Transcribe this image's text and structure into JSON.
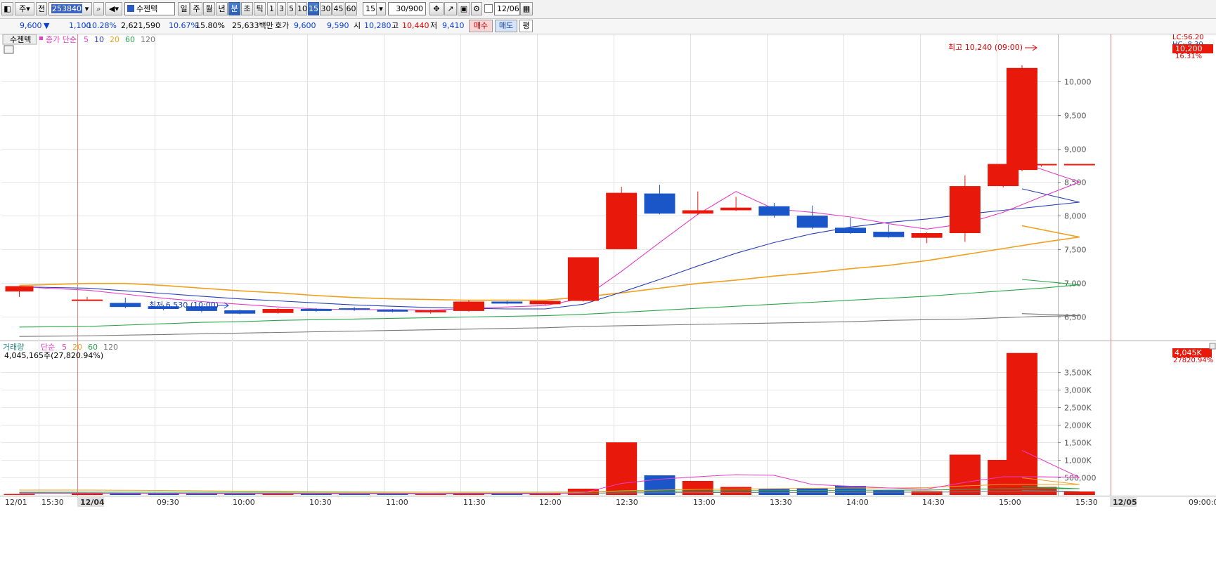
{
  "toolbar": {
    "period_label": "주",
    "prefix_label": "전",
    "code": "253840",
    "stock_name": "수젠텍",
    "tf_day": "일",
    "tf_week": "주",
    "tf_month": "월",
    "tf_year": "년",
    "tf_minute": "분",
    "tf_second": "초",
    "tf_tick": "틱",
    "intervals": [
      "1",
      "3",
      "5",
      "10",
      "15",
      "30",
      "45",
      "60"
    ],
    "interval_value": "15",
    "count_value": "30/900",
    "date_value": "12/06"
  },
  "info": {
    "price": "9,600",
    "change": "1,100",
    "change_pct": "-10.28%",
    "volume": "2,621,590",
    "pct1": "10.67%",
    "pct2": "15.80%",
    "amount": "25,633백만",
    "quote_label": "호가",
    "ask": "9,600",
    "bid": "9,590",
    "open_label": "시",
    "open": "10,280",
    "high_label": "고",
    "high": "10,440",
    "low_label": "저",
    "low": "9,410",
    "buy_label": "매수",
    "sell_label": "매도",
    "avg_label": "평"
  },
  "price_panel": {
    "legend_name": "수젠텍",
    "legend_ma_label": "종가 단순",
    "ma_periods": [
      "5",
      "10",
      "20",
      "60",
      "120"
    ],
    "annot_high": "최고 10,240 (09:00)",
    "annot_low": "최저 6,530 (10:00)",
    "lc_label": "LC:56.20",
    "hc_label": "HC:-8.30",
    "current_price": "10,200",
    "current_pct": "16.31%",
    "y_ticks": [
      "10,000",
      "9,500",
      "9,000",
      "8,500",
      "8,000",
      "7,500",
      "7,000",
      "6,500"
    ]
  },
  "volume_panel": {
    "legend_label": "거래량",
    "legend_ma_label": "단순",
    "ma_periods": [
      "5",
      "20",
      "60",
      "120"
    ],
    "current_text": "4,045,165주(27,820.94%)",
    "current_tag": "4,045K",
    "current_pct": "27820.94%",
    "y_ticks": [
      "3,500K",
      "3,000K",
      "2,500K",
      "2,000K",
      "1,500K",
      "1,000K",
      "500,000"
    ]
  },
  "x_axis": {
    "labels": [
      "12/01",
      "15:30",
      "12/04",
      "09:30",
      "10:00",
      "10:30",
      "11:00",
      "11:30",
      "12:00",
      "12:30",
      "13:00",
      "13:30",
      "14:00",
      "14:30",
      "15:00",
      "15:30",
      "12/05",
      "09:00:00"
    ]
  },
  "colors": {
    "up": "#e8190a",
    "down": "#1a56c8",
    "ma5": "#e63cc8",
    "ma10": "#2a3fb8",
    "ma20": "#f0a01e",
    "ma60": "#2aa64a",
    "ma120": "#777777"
  },
  "chart_data": {
    "type": "candlestick",
    "price": {
      "ylim": [
        6150,
        10700
      ],
      "candles": [
        {
          "x": "12/01 15:30",
          "open": 6870,
          "high": 6950,
          "low": 6790,
          "close": 6950
        },
        {
          "x": "12/04 09:00",
          "open": 6750,
          "high": 6790,
          "low": 6750,
          "close": 6750
        },
        {
          "x": "12/04 09:15",
          "open": 6700,
          "high": 6780,
          "low": 6620,
          "close": 6640
        },
        {
          "x": "12/04 09:30",
          "open": 6650,
          "high": 6670,
          "low": 6590,
          "close": 6610
        },
        {
          "x": "12/04 09:45",
          "open": 6650,
          "high": 6660,
          "low": 6560,
          "close": 6580
        },
        {
          "x": "12/04 10:00",
          "open": 6590,
          "high": 6600,
          "low": 6530,
          "close": 6540
        },
        {
          "x": "12/04 10:15",
          "open": 6550,
          "high": 6620,
          "low": 6540,
          "close": 6610
        },
        {
          "x": "12/04 10:30",
          "open": 6610,
          "high": 6620,
          "low": 6570,
          "close": 6580
        },
        {
          "x": "12/04 10:45",
          "open": 6620,
          "high": 6640,
          "low": 6580,
          "close": 6600
        },
        {
          "x": "12/04 11:00",
          "open": 6600,
          "high": 6610,
          "low": 6560,
          "close": 6570
        },
        {
          "x": "12/04 11:15",
          "open": 6560,
          "high": 6600,
          "low": 6540,
          "close": 6590
        },
        {
          "x": "12/04 11:30",
          "open": 6580,
          "high": 6740,
          "low": 6570,
          "close": 6720
        },
        {
          "x": "12/04 11:45",
          "open": 6720,
          "high": 6730,
          "low": 6680,
          "close": 6690
        },
        {
          "x": "12/04 12:00",
          "open": 6680,
          "high": 6730,
          "low": 6670,
          "close": 6730
        },
        {
          "x": "12/04 12:15",
          "open": 6730,
          "high": 7380,
          "low": 6720,
          "close": 7380
        },
        {
          "x": "12/04 12:30",
          "open": 7500,
          "high": 8430,
          "low": 7500,
          "close": 8340
        },
        {
          "x": "12/04 12:45",
          "open": 8330,
          "high": 8460,
          "low": 8020,
          "close": 8030
        },
        {
          "x": "12/04 13:00",
          "open": 8030,
          "high": 8360,
          "low": 8010,
          "close": 8080
        },
        {
          "x": "12/04 13:15",
          "open": 8080,
          "high": 8280,
          "low": 8070,
          "close": 8120
        },
        {
          "x": "12/04 13:30",
          "open": 8140,
          "high": 8190,
          "low": 7970,
          "close": 8000
        },
        {
          "x": "12/04 13:45",
          "open": 8000,
          "high": 8150,
          "low": 7800,
          "close": 7820
        },
        {
          "x": "12/04 14:00",
          "open": 7820,
          "high": 7970,
          "low": 7730,
          "close": 7740
        },
        {
          "x": "12/04 14:15",
          "open": 7760,
          "high": 7870,
          "low": 7670,
          "close": 7680
        },
        {
          "x": "12/04 14:30",
          "open": 7670,
          "high": 7750,
          "low": 7590,
          "close": 7740
        },
        {
          "x": "12/04 14:45",
          "open": 7740,
          "high": 8600,
          "low": 7610,
          "close": 8440
        },
        {
          "x": "12/04 15:00",
          "open": 8440,
          "high": 8770,
          "low": 8420,
          "close": 8770
        },
        {
          "x": "12/04 15:15",
          "open": 8760,
          "high": 8770,
          "low": 8730,
          "close": 8770
        },
        {
          "x": "12/04 15:30",
          "open": 8770,
          "high": 8770,
          "low": 8770,
          "close": 8770
        },
        {
          "x": "12/05 09:00",
          "open": 8680,
          "high": 10240,
          "low": 8660,
          "close": 10200
        }
      ],
      "ma": {
        "ma5": [
          6940,
          6890,
          6830,
          6770,
          6720,
          6680,
          6640,
          6610,
          6600,
          6600,
          6590,
          6620,
          6640,
          6660,
          6770,
          7170,
          7600,
          8020,
          8360,
          8100,
          8050,
          7980,
          7880,
          7800,
          7880,
          8050,
          8280,
          8500,
          8790
        ],
        "ma10": [
          6940,
          6920,
          6880,
          6840,
          6800,
          6760,
          6730,
          6700,
          6670,
          6650,
          6630,
          6620,
          6610,
          6610,
          6680,
          6860,
          7050,
          7250,
          7440,
          7600,
          7730,
          7830,
          7900,
          7950,
          8020,
          8080,
          8140,
          8200,
          8400
        ],
        "ma20": [
          6960,
          6990,
          6990,
          6960,
          6920,
          6880,
          6850,
          6810,
          6780,
          6760,
          6750,
          6740,
          6740,
          6740,
          6790,
          6850,
          6920,
          6990,
          7040,
          7100,
          7150,
          7210,
          7260,
          7330,
          7420,
          7510,
          7600,
          7680,
          7850
        ],
        "ma60": [
          6340,
          6350,
          6370,
          6390,
          6410,
          6420,
          6440,
          6450,
          6460,
          6470,
          6480,
          6490,
          6500,
          6510,
          6530,
          6560,
          6590,
          6620,
          6650,
          6680,
          6710,
          6740,
          6770,
          6800,
          6840,
          6880,
          6920,
          6970,
          7050
        ],
        "ma120": [
          6200,
          6210,
          6220,
          6230,
          6240,
          6250,
          6260,
          6270,
          6280,
          6290,
          6300,
          6310,
          6320,
          6330,
          6350,
          6360,
          6370,
          6380,
          6390,
          6400,
          6410,
          6420,
          6440,
          6450,
          6460,
          6480,
          6500,
          6510,
          6540
        ]
      }
    },
    "volume": {
      "ylim": [
        0,
        4200000
      ],
      "values": [
        30000,
        60000,
        45000,
        50000,
        40000,
        35000,
        45000,
        30000,
        25000,
        25000,
        20000,
        40000,
        30000,
        40000,
        180000,
        1500000,
        560000,
        400000,
        230000,
        170000,
        200000,
        260000,
        140000,
        110000,
        1150000,
        1000000,
        230000,
        100000,
        4045165
      ],
      "ma5": [
        60000,
        55000,
        50000,
        45000,
        40000,
        35000,
        35000,
        35000,
        35000,
        35000,
        35000,
        35000,
        35000,
        35000,
        65000,
        330000,
        450000,
        520000,
        580000,
        560000,
        300000,
        250000,
        200000,
        170000,
        360000,
        520000,
        520000,
        500000,
        1270000
      ],
      "ma20": [
        140000,
        140000,
        135000,
        130000,
        120000,
        110000,
        100000,
        95000,
        90000,
        85000,
        80000,
        75000,
        75000,
        75000,
        80000,
        120000,
        140000,
        160000,
        170000,
        180000,
        190000,
        200000,
        200000,
        210000,
        260000,
        300000,
        300000,
        300000,
        490000
      ],
      "ma60": [
        80000,
        80000,
        80000,
        80000,
        80000,
        80000,
        80000,
        80000,
        80000,
        80000,
        80000,
        80000,
        80000,
        80000,
        85000,
        100000,
        110000,
        115000,
        120000,
        125000,
        130000,
        135000,
        140000,
        140000,
        160000,
        180000,
        180000,
        180000,
        240000
      ],
      "ma120": [
        50000,
        50000,
        50000,
        50000,
        50000,
        50000,
        50000,
        50000,
        50000,
        50000,
        50000,
        50000,
        50000,
        50000,
        52000,
        60000,
        65000,
        68000,
        70000,
        72000,
        75000,
        78000,
        80000,
        80000,
        90000,
        100000,
        100000,
        100000,
        130000
      ]
    }
  }
}
